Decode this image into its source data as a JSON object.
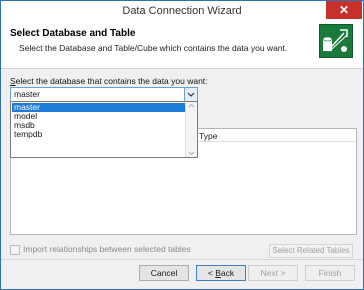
{
  "window": {
    "title": "Data Connection Wizard",
    "close_glyph": "✕"
  },
  "header": {
    "title": "Select Database and Table",
    "subtitle": "Select the Database and Table/Cube which contains the data you want.",
    "icon": "database-connection-icon"
  },
  "database": {
    "label_prefix": "S",
    "label_rest": "elect the database that contains the data you want:",
    "selected_value": "master",
    "options": [
      "master",
      "model",
      "msdb",
      "tempdb"
    ]
  },
  "table": {
    "columns": [
      "Type"
    ]
  },
  "options": {
    "import_relationships_label": "Import relationships between selected tables",
    "import_relationships_checked": false,
    "select_related_label": "Select Related Tables"
  },
  "buttons": {
    "cancel": "Cancel",
    "back_prefix": "< ",
    "back_key": "B",
    "back_rest": "ack",
    "next": "Next >",
    "finish": "Finish"
  },
  "colors": {
    "accent": "#1e7bd6",
    "close_button": "#c7302b",
    "wizard_icon": "#1a7a3c"
  }
}
